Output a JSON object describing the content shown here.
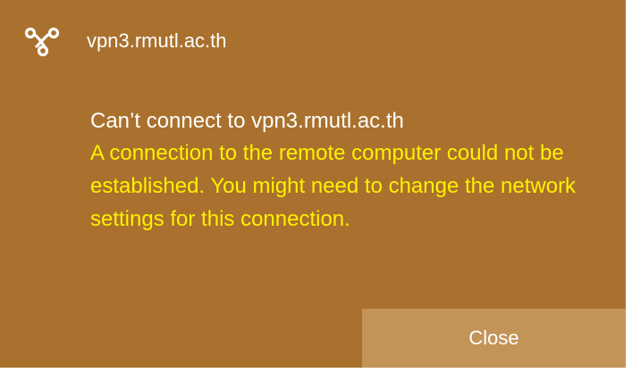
{
  "toast": {
    "app_title": "vpn3.rmutl.ac.th",
    "icon": "vpn-link-icon",
    "headline": "Can’t connect to vpn3.rmutl.ac.th",
    "message": "A connection to the remote computer could not be established.  You might need to change the network settings for this connection.",
    "close_label": "Close",
    "colors": {
      "background": "#a9712d",
      "button": "#c39458",
      "headline_text": "#ffffff",
      "message_text": "#fff000"
    }
  }
}
